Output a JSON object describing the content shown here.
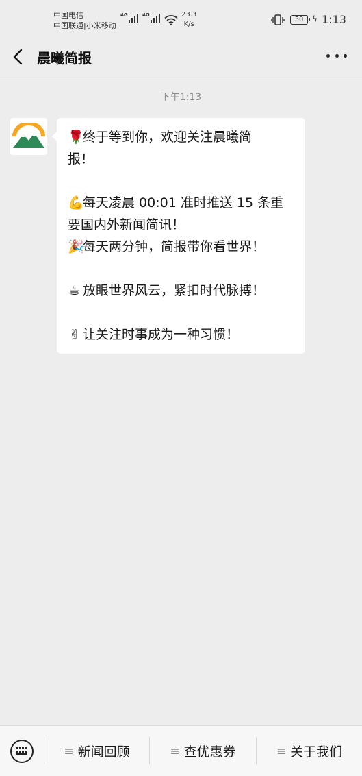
{
  "status_bar": {
    "carrier1": "中国电信",
    "carrier2": "中国联通|小米移动",
    "net1": "4G",
    "net2": "4G",
    "speed_value": "23.3",
    "speed_unit": "K/s",
    "battery": "30",
    "time": "1:13"
  },
  "nav": {
    "title": "晨曦简报",
    "back_icon": "chevron-left-icon",
    "more_icon": "more-dots-icon"
  },
  "chat": {
    "timestamp": "下午1:13",
    "avatar_icon": "mountain-logo",
    "lines": [
      {
        "emoji": "🌹",
        "text": "终于等到你，欢迎关注晨曦简"
      },
      {
        "emoji": "",
        "text": "报！"
      },
      {
        "emoji": "",
        "text": ""
      },
      {
        "emoji": "💪",
        "text": "每天凌晨 00:01 准时推送 15 条重"
      },
      {
        "emoji": "",
        "text": "要国内外新闻简讯！"
      },
      {
        "emoji": "🎉",
        "text": "每天两分钟，简报带你看世界！"
      },
      {
        "emoji": "",
        "text": ""
      },
      {
        "emoji": "☕",
        "text": "放眼世界风云，紧扣时代脉搏！"
      },
      {
        "emoji": "",
        "text": ""
      },
      {
        "emoji": "✌",
        "text": "让关注时事成为一种习惯！"
      }
    ]
  },
  "bottom_menu": {
    "keyboard_icon": "keyboard-icon",
    "items": [
      {
        "label": "新闻回顾"
      },
      {
        "label": "查优惠券"
      },
      {
        "label": "关于我们"
      }
    ]
  },
  "colors": {
    "background": "#ededed",
    "bubble": "#ffffff",
    "logo_orange": "#f5a623",
    "logo_green": "#2e8b57"
  }
}
